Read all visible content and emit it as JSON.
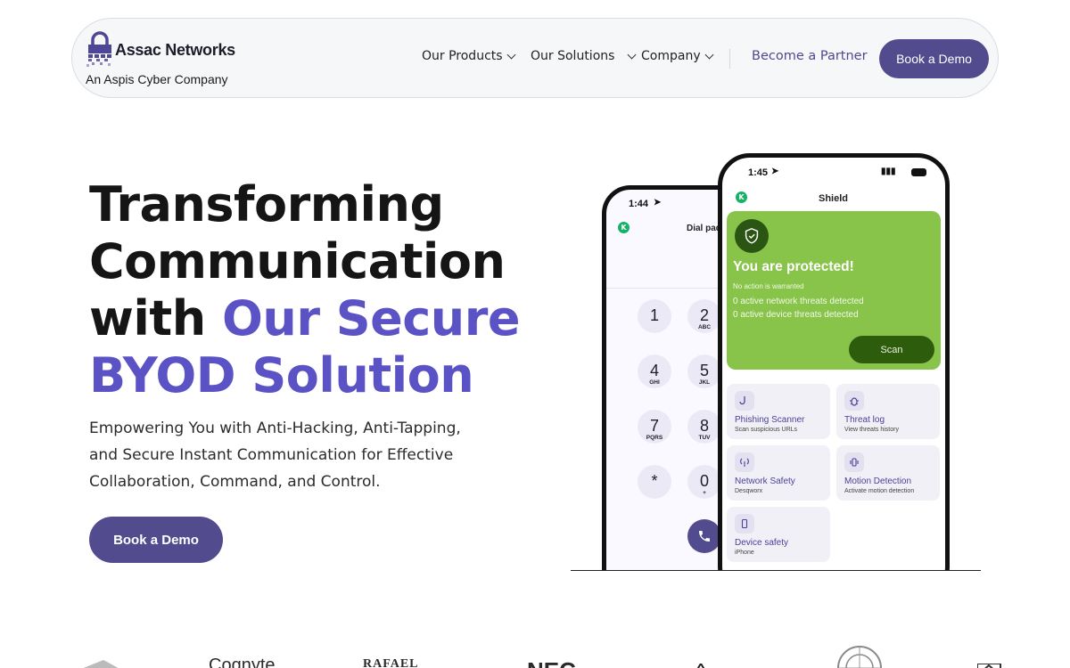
{
  "nav": {
    "logo_text": "Assac Networks",
    "tagline": "An Aspis Cyber Company",
    "items": [
      {
        "label": "Our Products"
      },
      {
        "label": "Our Solutions"
      },
      {
        "label": "Company"
      }
    ],
    "partner_link": "Become a Partner",
    "demo_button": "Book a Demo"
  },
  "hero": {
    "title_line1": "Transforming",
    "title_line2": "Communication",
    "title_line3_plain": "with",
    "title_line3_accent": "Our Secure",
    "title_line4_accent": "BYOD Solution",
    "subtitle": "Empowering You with Anti-Hacking, Anti-Tapping, and Secure Instant Communication for Effective Collaboration, Command, and Control.",
    "cta_label": "Book a Demo",
    "accent_color": "#5b52c6",
    "button_color": "#524b8d"
  },
  "phone_back": {
    "time": "1:44",
    "app_avatar": "K",
    "app_title": "Dial pad",
    "keys": [
      {
        "digit": "1",
        "letters": ""
      },
      {
        "digit": "2",
        "letters": "ABC"
      },
      {
        "digit": "4",
        "letters": "GHI"
      },
      {
        "digit": "5",
        "letters": "JKL"
      },
      {
        "digit": "7",
        "letters": "PQRS"
      },
      {
        "digit": "8",
        "letters": "TUV"
      },
      {
        "digit": "*",
        "letters": ""
      },
      {
        "digit": "0",
        "letters": "+"
      }
    ]
  },
  "phone_front": {
    "time": "1:45",
    "app_avatar": "K",
    "app_title": "Shield",
    "status_title": "You are protected!",
    "status_note": "No action is warranted",
    "network_threats": "0 active network threats detected",
    "device_threats": "0 active device threats detected",
    "scan_button": "Scan",
    "tiles": [
      {
        "title": "Phishing Scanner",
        "subtitle": "Scan suspicious URLs",
        "icon": "hook-icon"
      },
      {
        "title": "Threat log",
        "subtitle": "View threats history",
        "icon": "bug-icon"
      },
      {
        "title": "Network Safety",
        "subtitle": "Desqworx",
        "icon": "antenna-icon"
      },
      {
        "title": "Motion Detection",
        "subtitle": "Activate motion detection",
        "icon": "vibration-icon"
      },
      {
        "title": "Device safety",
        "subtitle": "iPhone",
        "icon": "phone-icon"
      }
    ]
  },
  "partner_logos": [
    "Cognyte",
    "RAFAEL",
    "NEC"
  ]
}
